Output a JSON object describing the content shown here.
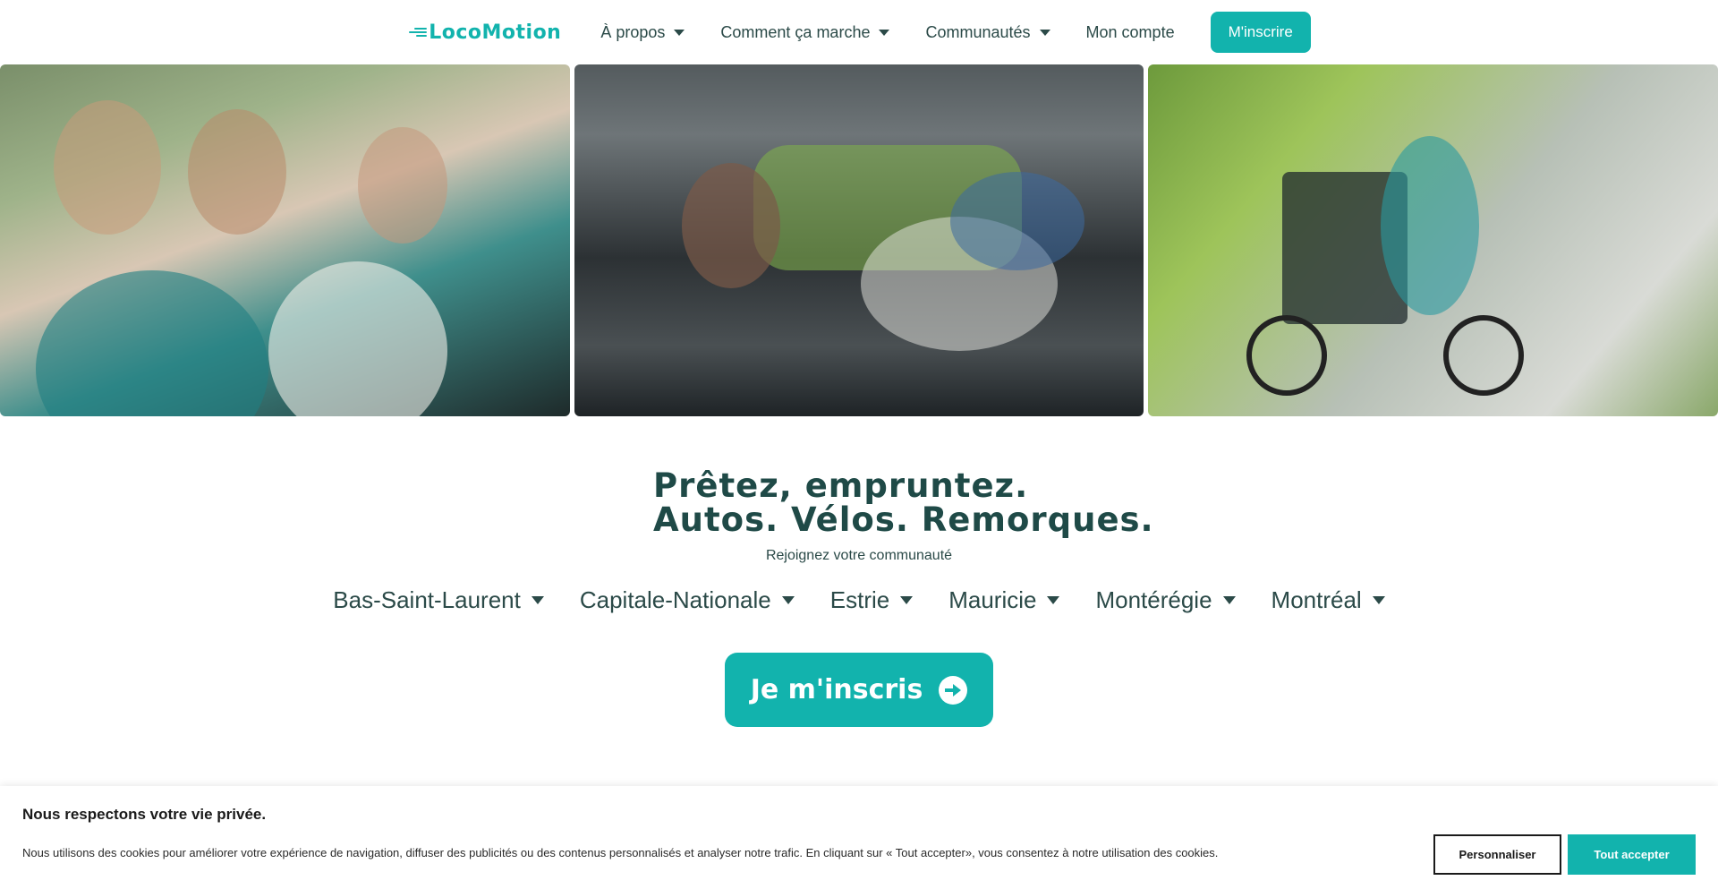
{
  "nav": {
    "logo_text": "LocoMotion",
    "items": [
      {
        "label": "À propos",
        "dropdown": true
      },
      {
        "label": "Comment ça marche",
        "dropdown": true
      },
      {
        "label": "Communautés",
        "dropdown": true
      },
      {
        "label": "Mon compte",
        "dropdown": false
      }
    ],
    "cta_label": "M'inscrire"
  },
  "hero": {
    "headline_line1": "Prêtez, empruntez.",
    "headline_line2": "Autos. Vélos. Remorques.",
    "subline": "Rejoignez votre communauté",
    "regions": [
      "Bas-Saint-Laurent",
      "Capitale-Nationale",
      "Estrie",
      "Mauricie",
      "Montérégie",
      "Montréal"
    ],
    "cta_label": "Je m'inscris"
  },
  "cookie": {
    "title": "Nous respectons votre vie privée.",
    "text": "Nous utilisons des cookies pour améliorer votre expérience de navigation, diffuser des publicités ou des contenus personnalisés et analyser notre trafic. En cliquant sur « Tout accepter», vous consentez à notre utilisation des cookies.",
    "customize_label": "Personnaliser",
    "accept_label": "Tout accepter"
  },
  "colors": {
    "brand": "#12b3ad",
    "text_dark": "#1f4a47"
  },
  "icons": {
    "dropdown": "caret-down-icon",
    "cta_arrow": "arrow-circle-right-icon"
  }
}
